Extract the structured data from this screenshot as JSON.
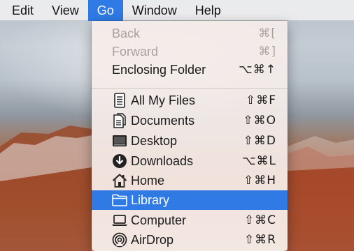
{
  "menubar": {
    "items": [
      {
        "label": "Edit"
      },
      {
        "label": "View"
      },
      {
        "label": "Go"
      },
      {
        "label": "Window"
      },
      {
        "label": "Help"
      }
    ],
    "active": "Go"
  },
  "go_menu": {
    "items": [
      {
        "label": "Back",
        "shortcut": "⌘[",
        "enabled": false
      },
      {
        "label": "Forward",
        "shortcut": "⌘]",
        "enabled": false
      },
      {
        "label": "Enclosing Folder",
        "shortcut": "⌥⌘↑",
        "enabled": true
      },
      {
        "label": "All My Files",
        "shortcut": "⇧⌘F",
        "icon": "all-my-files-icon"
      },
      {
        "label": "Documents",
        "shortcut": "⇧⌘O",
        "icon": "documents-icon"
      },
      {
        "label": "Desktop",
        "shortcut": "⇧⌘D",
        "icon": "desktop-icon"
      },
      {
        "label": "Downloads",
        "shortcut": "⌥⌘L",
        "icon": "downloads-icon"
      },
      {
        "label": "Home",
        "shortcut": "⇧⌘H",
        "icon": "home-icon"
      },
      {
        "label": "Library",
        "shortcut": "",
        "icon": "folder-icon",
        "selected": true
      },
      {
        "label": "Computer",
        "shortcut": "⇧⌘C",
        "icon": "computer-icon"
      },
      {
        "label": "AirDrop",
        "shortcut": "⇧⌘R",
        "icon": "airdrop-icon"
      }
    ]
  },
  "colors": {
    "selection": "#2f7ae5",
    "menu_text": "#1a1a1a",
    "disabled_text": "#a7a3a0"
  }
}
